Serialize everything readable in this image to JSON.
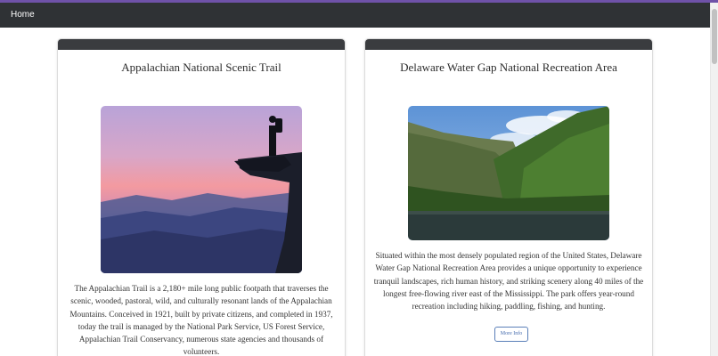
{
  "navbar": {
    "home_label": "Home"
  },
  "cards": [
    {
      "title": "Appalachian National Scenic Trail",
      "image": "hiker-silhouette-on-cliff-at-sunset",
      "description": "The Appalachian Trail is a 2,180+ mile long public footpath that traverses the scenic, wooded, pastoral, wild, and culturally resonant lands of the Appalachian Mountains. Conceived in 1921, built by private citizens, and completed in 1937, today the trail is managed by the National Park Service, US Forest Service, Appalachian Trail Conservancy, numerous state agencies and thousands of volunteers."
    },
    {
      "title": "Delaware Water Gap National Recreation Area",
      "image": "river-gap-between-forested-mountains",
      "description": "Situated within the most densely populated region of the United States, Delaware Water Gap National Recreation Area provides a unique opportunity to experience tranquil landscapes, rich human history, and striking scenery along 40 miles of the longest free-flowing river east of the Mississippi. The park offers year-round recreation including hiking, paddling, fishing, and hunting.",
      "button_label": "More Info"
    }
  ],
  "colors": {
    "accent": "#6f52a8",
    "navbar": "#2f3235",
    "card_header": "#3a3c3f",
    "button_border": "#5a7fb8"
  }
}
